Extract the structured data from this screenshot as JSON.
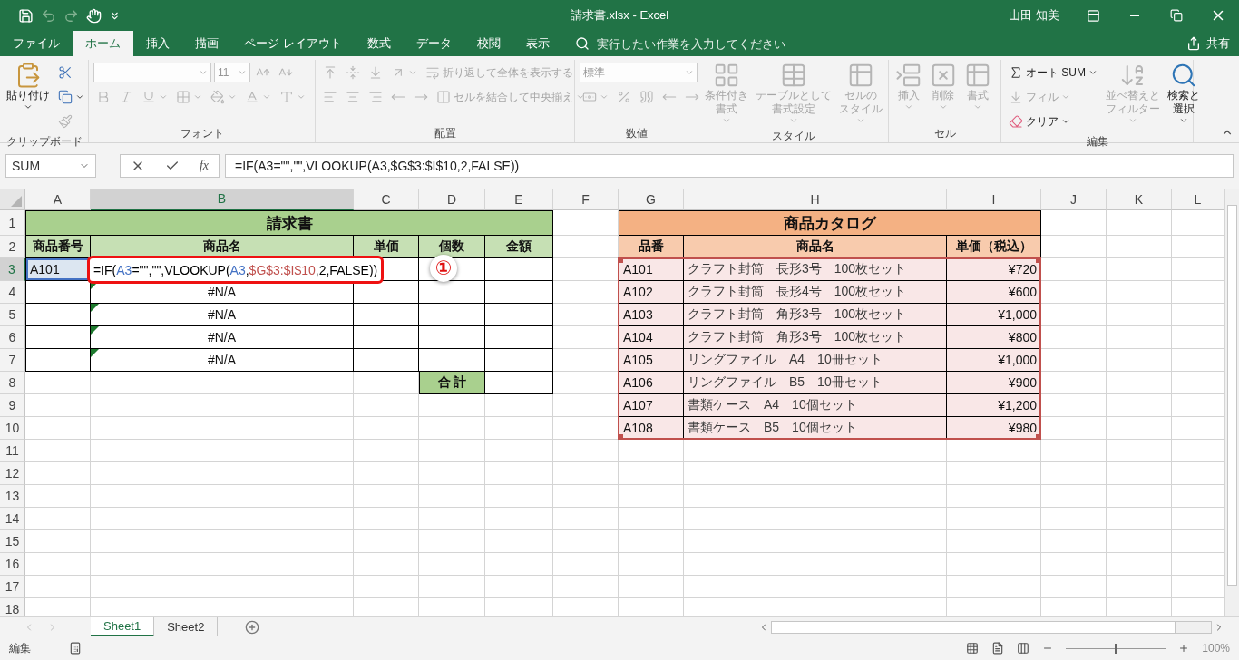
{
  "window": {
    "title": "請求書.xlsx - Excel",
    "user": "山田 知美"
  },
  "menu_tabs": [
    {
      "label": "ファイル",
      "selected": false
    },
    {
      "label": "ホーム",
      "selected": true
    },
    {
      "label": "挿入",
      "selected": false
    },
    {
      "label": "描画",
      "selected": false
    },
    {
      "label": "ページ レイアウト",
      "selected": false
    },
    {
      "label": "数式",
      "selected": false
    },
    {
      "label": "データ",
      "selected": false
    },
    {
      "label": "校閲",
      "selected": false
    },
    {
      "label": "表示",
      "selected": false
    }
  ],
  "tell_me": {
    "placeholder": "実行したい作業を入力してください"
  },
  "share": "共有",
  "ribbon": {
    "groups": [
      {
        "label": "クリップボード",
        "columns": [
          {
            "kind": "large",
            "label_lines": [
              "貼り付け"
            ],
            "disabled": false,
            "dropdown": true
          },
          {
            "kind": "stack",
            "rows": [
              [
                {
                  "kind": "icon",
                  "disabled": false,
                  "dropdown": false
                }
              ],
              [
                {
                  "kind": "icon",
                  "disabled": false,
                  "dropdown": true
                }
              ],
              [
                {
                  "kind": "icon",
                  "disabled": true,
                  "dropdown": false
                }
              ]
            ]
          }
        ]
      },
      {
        "label": "フォント",
        "columns": [
          {
            "kind": "stack",
            "rows": [
              [
                {
                  "kind": "wide_field",
                  "disabled": true,
                  "dropdown": true
                },
                {
                  "kind": "field",
                  "value": "11",
                  "disabled": true,
                  "dropdown": true
                },
                {
                  "kind": "icon",
                  "disabled": true,
                  "dropdown": false
                },
                {
                  "kind": "icon",
                  "disabled": true,
                  "dropdown": false
                }
              ],
              [
                {
                  "kind": "icon",
                  "disabled": true,
                  "dropdown": false
                },
                {
                  "kind": "icon",
                  "disabled": true,
                  "dropdown": false
                },
                {
                  "kind": "icon",
                  "disabled": true,
                  "dropdown": true
                },
                {
                  "kind": "icon",
                  "disabled": true,
                  "dropdown": true
                },
                {
                  "kind": "icon",
                  "disabled": true,
                  "dropdown": true
                },
                {
                  "kind": "icon",
                  "disabled": true,
                  "dropdown": true
                },
                {
                  "kind": "icon",
                  "disabled": true,
                  "dropdown": true
                }
              ]
            ]
          }
        ]
      },
      {
        "label": "配置",
        "columns": [
          {
            "kind": "stack",
            "rows": [
              [
                {
                  "kind": "icon",
                  "disabled": true,
                  "dropdown": false
                },
                {
                  "kind": "icon",
                  "disabled": true,
                  "dropdown": false
                },
                {
                  "kind": "icon",
                  "disabled": true,
                  "dropdown": false
                },
                {
                  "kind": "icon",
                  "disabled": true,
                  "dropdown": true
                },
                {
                  "kind": "text",
                  "label": "折り返して全体を表示する",
                  "disabled": true,
                  "dropdown": false
                }
              ],
              [
                {
                  "kind": "icon",
                  "disabled": true,
                  "dropdown": false
                },
                {
                  "kind": "icon",
                  "disabled": true,
                  "dropdown": false
                },
                {
                  "kind": "icon",
                  "disabled": true,
                  "dropdown": false
                },
                {
                  "kind": "icon",
                  "disabled": true,
                  "dropdown": false
                },
                {
                  "kind": "icon",
                  "disabled": true,
                  "dropdown": false
                },
                {
                  "kind": "text",
                  "label": "セルを結合して中央揃え",
                  "disabled": true,
                  "dropdown": true
                }
              ]
            ]
          }
        ]
      },
      {
        "label": "数値",
        "columns": [
          {
            "kind": "stack",
            "rows": [
              [
                {
                  "kind": "wide_field",
                  "value": "標準",
                  "disabled": true,
                  "dropdown": true
                }
              ],
              [
                {
                  "kind": "icon",
                  "disabled": true,
                  "dropdown": true
                },
                {
                  "kind": "icon",
                  "disabled": true,
                  "dropdown": false
                },
                {
                  "kind": "icon",
                  "disabled": true,
                  "dropdown": false
                },
                {
                  "kind": "icon",
                  "disabled": true,
                  "dropdown": false
                },
                {
                  "kind": "icon",
                  "disabled": true,
                  "dropdown": false
                }
              ]
            ]
          }
        ]
      },
      {
        "label": "スタイル",
        "columns": [
          {
            "kind": "large",
            "label_lines": [
              "条件付き",
              "書式"
            ],
            "disabled": true,
            "dropdown": true
          },
          {
            "kind": "large",
            "label_lines": [
              "テーブルとして",
              "書式設定"
            ],
            "disabled": true,
            "dropdown": true
          },
          {
            "kind": "large",
            "label_lines": [
              "セルの",
              "スタイル"
            ],
            "disabled": true,
            "dropdown": true
          }
        ]
      },
      {
        "label": "セル",
        "columns": [
          {
            "kind": "large",
            "label_lines": [
              "挿入"
            ],
            "disabled": true,
            "dropdown": true
          },
          {
            "kind": "large",
            "label_lines": [
              "削除"
            ],
            "disabled": true,
            "dropdown": true
          },
          {
            "kind": "large",
            "label_lines": [
              "書式"
            ],
            "disabled": true,
            "dropdown": true
          }
        ]
      },
      {
        "label": "編集",
        "columns": [
          {
            "kind": "stack",
            "rows": [
              [
                {
                  "kind": "text",
                  "label": "オート SUM",
                  "disabled": false,
                  "dropdown": true
                }
              ],
              [
                {
                  "kind": "text",
                  "label": "フィル",
                  "disabled": true,
                  "dropdown": true
                }
              ],
              [
                {
                  "kind": "text",
                  "label": "クリア",
                  "disabled": false,
                  "dropdown": true
                }
              ]
            ]
          },
          {
            "kind": "large",
            "label_lines": [
              "並べ替えと",
              "フィルター"
            ],
            "disabled": true,
            "dropdown": true
          },
          {
            "kind": "large",
            "label_lines": [
              "検索と",
              "選択"
            ],
            "disabled": false,
            "dropdown": true
          }
        ]
      }
    ]
  },
  "formula_bar": {
    "name_box": "SUM",
    "function_label": "fx",
    "formula": "=IF(A3=\"\",\"\",VLOOKUP(A3,$G$3:$I$10,2,FALSE))"
  },
  "sheet": {
    "column_headers": [
      {
        "label": "A",
        "selected": false
      },
      {
        "label": "B",
        "selected": true
      },
      {
        "label": "C",
        "selected": false
      },
      {
        "label": "D",
        "selected": false
      },
      {
        "label": "E",
        "selected": false
      },
      {
        "label": "F",
        "selected": false
      },
      {
        "label": "G",
        "selected": false
      },
      {
        "label": "H",
        "selected": false
      },
      {
        "label": "I",
        "selected": false
      },
      {
        "label": "J",
        "selected": false
      },
      {
        "label": "K",
        "selected": false
      },
      {
        "label": "L",
        "selected": false
      }
    ],
    "row_headers": [
      {
        "label": "1",
        "selected": false
      },
      {
        "label": "2",
        "selected": false
      },
      {
        "label": "3",
        "selected": true
      },
      {
        "label": "4",
        "selected": false
      },
      {
        "label": "5",
        "selected": false
      },
      {
        "label": "6",
        "selected": false
      },
      {
        "label": "7",
        "selected": false
      },
      {
        "label": "8",
        "selected": false
      },
      {
        "label": "9",
        "selected": false
      },
      {
        "label": "10",
        "selected": false
      },
      {
        "label": "11",
        "selected": false
      },
      {
        "label": "12",
        "selected": false
      },
      {
        "label": "13",
        "selected": false
      },
      {
        "label": "14",
        "selected": false
      },
      {
        "label": "15",
        "selected": false
      },
      {
        "label": "16",
        "selected": false
      },
      {
        "label": "17",
        "selected": false
      },
      {
        "label": "18",
        "selected": false
      }
    ]
  },
  "invoice": {
    "title": "請求書",
    "headers": [
      "商品番号",
      "商品名",
      "単価",
      "個数",
      "金額"
    ],
    "rows": [
      {
        "code": "A101",
        "referenced": true,
        "error_flag": false,
        "formula": [
          {
            "text": "=IF("
          },
          {
            "text": "A3",
            "color": "#4472c4"
          },
          {
            "text": "=\"\",\"\",VLOOKUP("
          },
          {
            "text": "A3",
            "color": "#4472c4"
          },
          {
            "text": ","
          },
          {
            "text": "$G$3:$I$10",
            "color": "#c0504d"
          },
          {
            "text": ",2,FALSE))"
          }
        ]
      },
      {
        "name": "#N/A",
        "referenced": false,
        "error_flag": true
      },
      {
        "name": "#N/A",
        "referenced": false,
        "error_flag": true
      },
      {
        "name": "#N/A",
        "referenced": false,
        "error_flag": true
      },
      {
        "name": "#N/A",
        "referenced": false,
        "error_flag": true
      }
    ],
    "total_label": "合 計"
  },
  "catalog": {
    "title": "商品カタログ",
    "headers": [
      "品番",
      "商品名",
      "単価（税込）"
    ],
    "referenced": true,
    "rows": [
      [
        "A101",
        "クラフト封筒　長形3号　100枚セット",
        "¥720"
      ],
      [
        "A102",
        "クラフト封筒　長形4号　100枚セット",
        "¥600"
      ],
      [
        "A103",
        "クラフト封筒　角形3号　100枚セット",
        "¥1,000"
      ],
      [
        "A104",
        "クラフト封筒　角形3号　100枚セット",
        "¥800"
      ],
      [
        "A105",
        "リングファイル　A4　10冊セット",
        "¥1,000"
      ],
      [
        "A106",
        "リングファイル　B5　10冊セット",
        "¥900"
      ],
      [
        "A107",
        "書類ケース　A4　10個セット",
        "¥1,200"
      ],
      [
        "A108",
        "書類ケース　B5　10個セット",
        "¥980"
      ]
    ]
  },
  "callout": "①",
  "sheet_tabs": [
    {
      "label": "Sheet1",
      "selected": true
    },
    {
      "label": "Sheet2",
      "selected": false
    }
  ],
  "status_bar": {
    "mode": "編集",
    "zoom": {
      "level": 0.5,
      "reading": "100%"
    }
  }
}
